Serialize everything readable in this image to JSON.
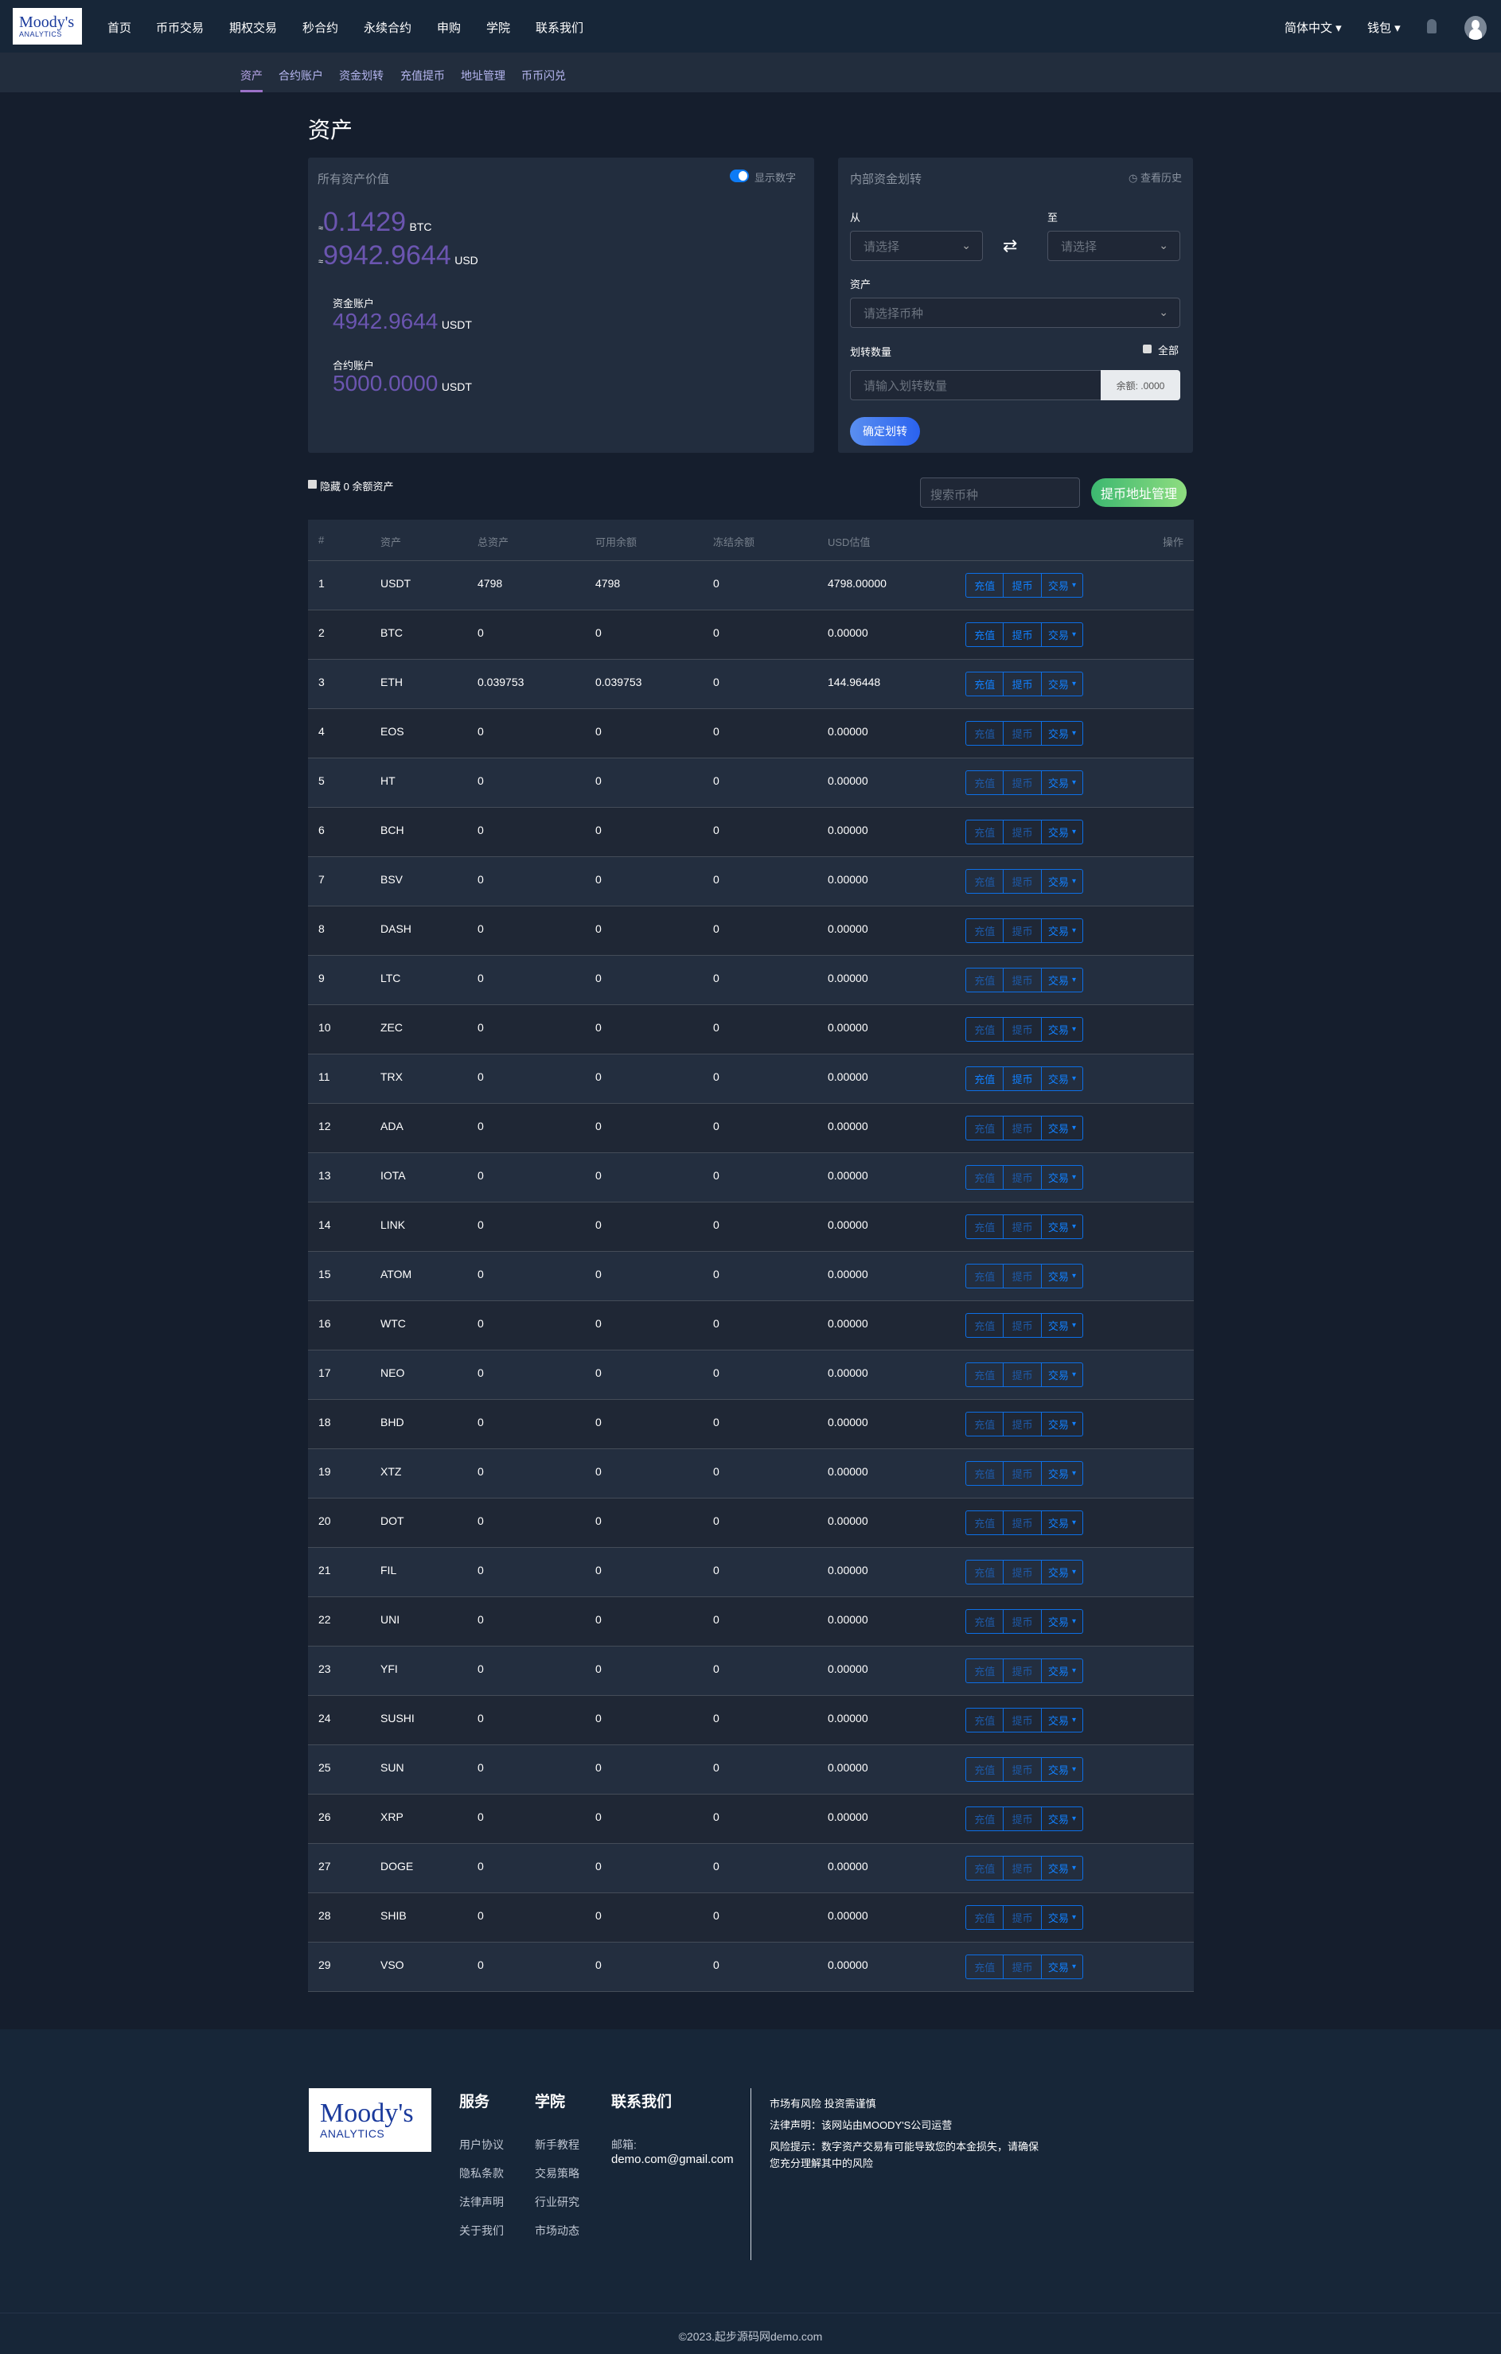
{
  "header": {
    "logo_line1": "Moody's",
    "logo_line2": "ANALYTICS",
    "nav": [
      "首页",
      "币币交易",
      "期权交易",
      "秒合约",
      "永续合约",
      "申购",
      "学院",
      "联系我们"
    ],
    "language": "简体中文",
    "wallet": "钱包"
  },
  "subnav": [
    "资产",
    "合约账户",
    "资金划转",
    "充值提币",
    "地址管理",
    "币币闪兑"
  ],
  "page_title": "资产",
  "summary": {
    "title": "所有资产价值",
    "toggle_label": "显示数字",
    "toggle_on": true,
    "approx": "≈",
    "btc_value": "0.1429",
    "btc_unit": "BTC",
    "usd_value": "9942.9644",
    "usd_unit": "USD",
    "fund_label": "资金账户",
    "fund_value": "4942.9644",
    "fund_unit": "USDT",
    "contract_label": "合约账户",
    "contract_value": "5000.0000",
    "contract_unit": "USDT"
  },
  "transfer": {
    "title": "内部资金划转",
    "history": "查看历史",
    "from_label": "从",
    "to_label": "至",
    "from_placeholder": "请选择",
    "to_placeholder": "请选择",
    "asset_label": "资产",
    "asset_placeholder": "请选择币种",
    "amount_label": "划转数量",
    "all_label": "全部",
    "amount_placeholder": "请输入划转数量",
    "balance": "余额: .0000",
    "submit": "确定划转"
  },
  "toolbar": {
    "hide_zero": "隐藏 0 余额资产",
    "search_placeholder": "搜索币种",
    "address_btn": "提币地址管理"
  },
  "table": {
    "headers": [
      "#",
      "资产",
      "总资产",
      "可用余额",
      "冻结余额",
      "USD估值",
      "操作"
    ],
    "actions": [
      "充值",
      "提币",
      "交易"
    ],
    "rows": [
      [
        "1",
        "USDT",
        "4798",
        "4798",
        "0",
        "4798.00000",
        true
      ],
      [
        "2",
        "BTC",
        "0",
        "0",
        "0",
        "0.00000",
        true
      ],
      [
        "3",
        "ETH",
        "0.039753",
        "0.039753",
        "0",
        "144.96448",
        true
      ],
      [
        "4",
        "EOS",
        "0",
        "0",
        "0",
        "0.00000",
        false
      ],
      [
        "5",
        "HT",
        "0",
        "0",
        "0",
        "0.00000",
        false
      ],
      [
        "6",
        "BCH",
        "0",
        "0",
        "0",
        "0.00000",
        false
      ],
      [
        "7",
        "BSV",
        "0",
        "0",
        "0",
        "0.00000",
        false
      ],
      [
        "8",
        "DASH",
        "0",
        "0",
        "0",
        "0.00000",
        false
      ],
      [
        "9",
        "LTC",
        "0",
        "0",
        "0",
        "0.00000",
        false
      ],
      [
        "10",
        "ZEC",
        "0",
        "0",
        "0",
        "0.00000",
        false
      ],
      [
        "11",
        "TRX",
        "0",
        "0",
        "0",
        "0.00000",
        true
      ],
      [
        "12",
        "ADA",
        "0",
        "0",
        "0",
        "0.00000",
        false
      ],
      [
        "13",
        "IOTA",
        "0",
        "0",
        "0",
        "0.00000",
        false
      ],
      [
        "14",
        "LINK",
        "0",
        "0",
        "0",
        "0.00000",
        false
      ],
      [
        "15",
        "ATOM",
        "0",
        "0",
        "0",
        "0.00000",
        false
      ],
      [
        "16",
        "WTC",
        "0",
        "0",
        "0",
        "0.00000",
        false
      ],
      [
        "17",
        "NEO",
        "0",
        "0",
        "0",
        "0.00000",
        false
      ],
      [
        "18",
        "BHD",
        "0",
        "0",
        "0",
        "0.00000",
        false
      ],
      [
        "19",
        "XTZ",
        "0",
        "0",
        "0",
        "0.00000",
        false
      ],
      [
        "20",
        "DOT",
        "0",
        "0",
        "0",
        "0.00000",
        false
      ],
      [
        "21",
        "FIL",
        "0",
        "0",
        "0",
        "0.00000",
        false
      ],
      [
        "22",
        "UNI",
        "0",
        "0",
        "0",
        "0.00000",
        false
      ],
      [
        "23",
        "YFI",
        "0",
        "0",
        "0",
        "0.00000",
        false
      ],
      [
        "24",
        "SUSHI",
        "0",
        "0",
        "0",
        "0.00000",
        false
      ],
      [
        "25",
        "SUN",
        "0",
        "0",
        "0",
        "0.00000",
        false
      ],
      [
        "26",
        "XRP",
        "0",
        "0",
        "0",
        "0.00000",
        false
      ],
      [
        "27",
        "DOGE",
        "0",
        "0",
        "0",
        "0.00000",
        false
      ],
      [
        "28",
        "SHIB",
        "0",
        "0",
        "0",
        "0.00000",
        false
      ],
      [
        "29",
        "VSO",
        "0",
        "0",
        "0",
        "0.00000",
        false
      ]
    ]
  },
  "footer": {
    "services_title": "服务",
    "services": [
      "用户协议",
      "隐私条款",
      "法律声明",
      "关于我们"
    ],
    "academy_title": "学院",
    "academy": [
      "新手教程",
      "交易策略",
      "行业研究",
      "市场动态"
    ],
    "contact_title": "联系我们",
    "email_label": "邮箱:",
    "email": "demo.com@gmail.com",
    "notice1": "市场有风险 投资需谨慎",
    "notice2": "法律声明：该网站由MOODY'S公司运营",
    "notice3": "风险提示：数字资产交易有可能导致您的本金损失，请确保您充分理解其中的风险",
    "copyright": "©2023.起步源码网demo.com"
  },
  "colors": {
    "accent": "#0d6fe6",
    "purple": "#6b55b0",
    "green": "#3dba6a"
  }
}
